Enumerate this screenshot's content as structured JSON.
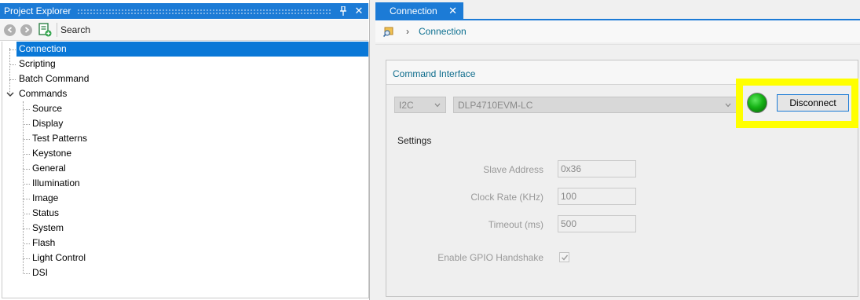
{
  "explorer": {
    "title": "Project Explorer",
    "pin_icon": "pin-icon",
    "close_glyph": "✕",
    "search_label": "Search",
    "tree": [
      {
        "label": "Connection",
        "selected": true
      },
      {
        "label": "Scripting"
      },
      {
        "label": "Batch Command"
      },
      {
        "label": "Commands",
        "expanded": true
      },
      {
        "label": "Source"
      },
      {
        "label": "Display"
      },
      {
        "label": "Test Patterns"
      },
      {
        "label": "Keystone"
      },
      {
        "label": "General"
      },
      {
        "label": "Illumination"
      },
      {
        "label": "Image"
      },
      {
        "label": "Status"
      },
      {
        "label": "System"
      },
      {
        "label": "Flash"
      },
      {
        "label": "Light Control"
      },
      {
        "label": "DSI"
      }
    ]
  },
  "document": {
    "tab": {
      "label": "Connection",
      "close_glyph": "✕"
    },
    "breadcrumb": {
      "separator": "›",
      "current": "Connection"
    },
    "command_interface": {
      "title": "Command Interface",
      "interface_select": "I2C",
      "device_select": "DLP4710EVM-LC",
      "status_led": "connected",
      "status_color": "#15b215",
      "disconnect_label": "Disconnect"
    },
    "settings": {
      "title": "Settings",
      "slave_address_label": "Slave Address",
      "slave_address_value": "0x36",
      "clock_rate_label": "Clock Rate (KHz)",
      "clock_rate_value": "100",
      "timeout_label": "Timeout (ms)",
      "timeout_value": "500",
      "gpio_handshake_label": "Enable GPIO Handshake",
      "gpio_handshake_checked": true
    }
  },
  "colors": {
    "accent": "#1c7bd6",
    "selection": "#0a78d7",
    "highlight": "#ffff00",
    "section_title": "#0e6c8c"
  }
}
